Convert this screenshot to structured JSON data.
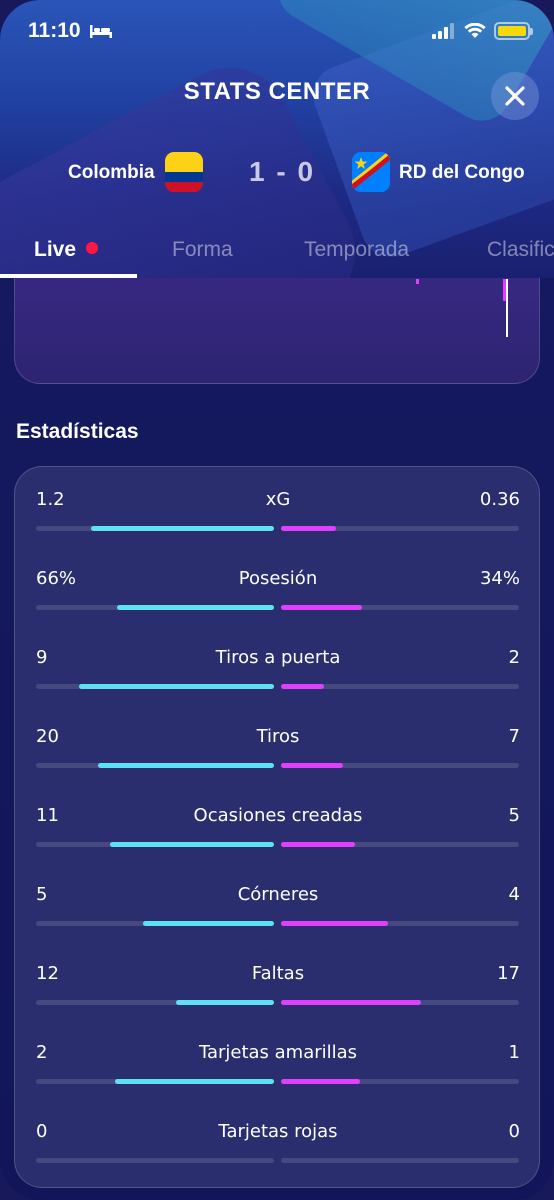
{
  "status": {
    "time": "11:10"
  },
  "header": {
    "title": "STATS CENTER"
  },
  "match": {
    "home": "Colombia",
    "away": "RD del Congo",
    "score": "1 - 0"
  },
  "tabs": [
    {
      "label": "Live",
      "active": true
    },
    {
      "label": "Forma"
    },
    {
      "label": "Temporada"
    },
    {
      "label": "Clasific"
    }
  ],
  "section": {
    "title": "Estadísticas"
  },
  "colors": {
    "home_bar": "#5ee2f2",
    "away_bar": "#e040fb",
    "live_dot": "#ff1744"
  },
  "stats": [
    {
      "label": "xG",
      "home": "1.2",
      "away": "0.36",
      "home_frac": 0.77,
      "away_frac": 0.23
    },
    {
      "label": "Posesión",
      "home": "66%",
      "away": "34%",
      "home_frac": 0.66,
      "away_frac": 0.34
    },
    {
      "label": "Tiros a puerta",
      "home": "9",
      "away": "2",
      "home_frac": 0.82,
      "away_frac": 0.18
    },
    {
      "label": "Tiros",
      "home": "20",
      "away": "7",
      "home_frac": 0.74,
      "away_frac": 0.26
    },
    {
      "label": "Ocasiones creadas",
      "home": "11",
      "away": "5",
      "home_frac": 0.69,
      "away_frac": 0.31
    },
    {
      "label": "Córneres",
      "home": "5",
      "away": "4",
      "home_frac": 0.55,
      "away_frac": 0.45
    },
    {
      "label": "Faltas",
      "home": "12",
      "away": "17",
      "home_frac": 0.41,
      "away_frac": 0.59
    },
    {
      "label": "Tarjetas amarillas",
      "home": "2",
      "away": "1",
      "home_frac": 0.67,
      "away_frac": 0.33
    },
    {
      "label": "Tarjetas rojas",
      "home": "0",
      "away": "0",
      "home_frac": 0,
      "away_frac": 0
    }
  ]
}
